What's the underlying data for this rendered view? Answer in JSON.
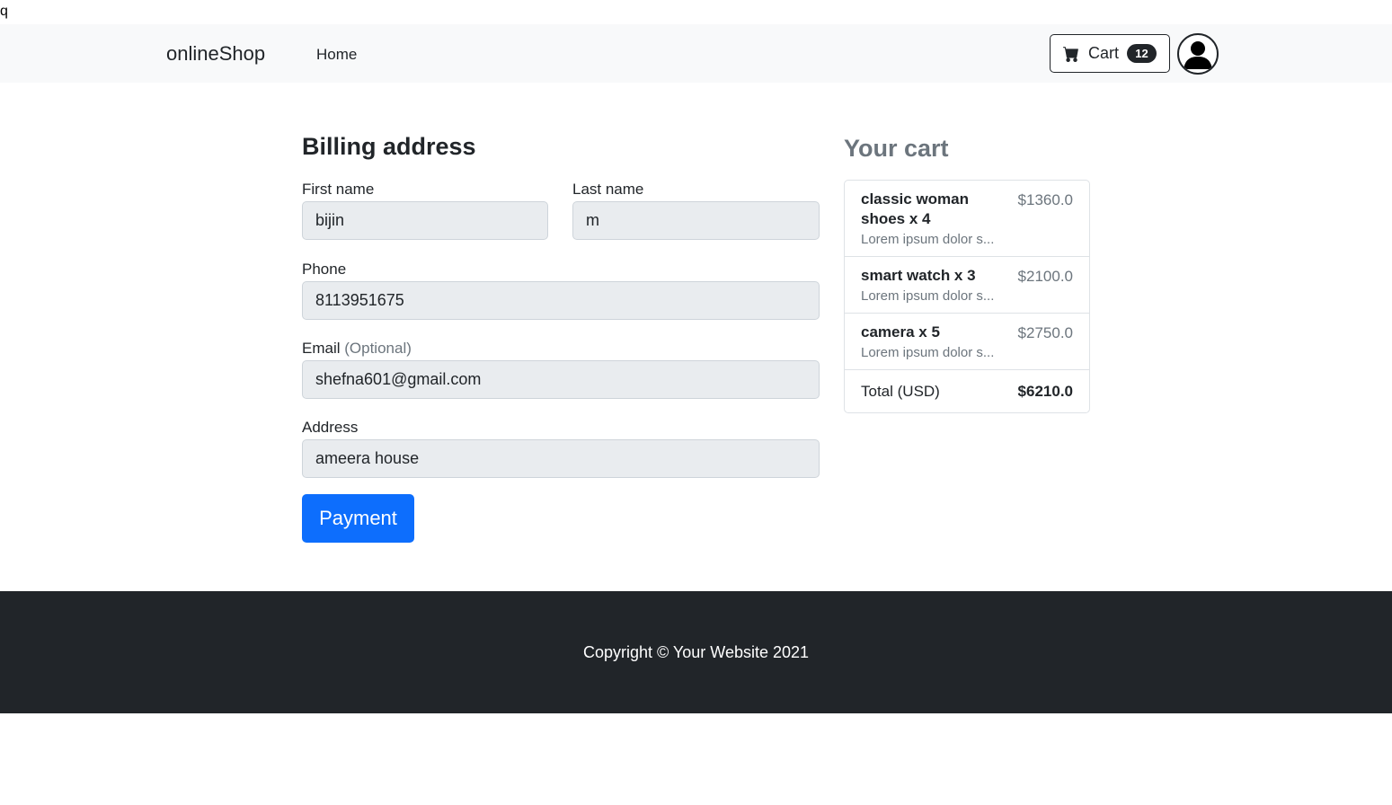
{
  "stray_text": "q",
  "navbar": {
    "brand": "onlineShop",
    "links": [
      {
        "label": "Home"
      }
    ],
    "cart": {
      "label": "Cart",
      "count": "12",
      "icon": "cart-icon"
    },
    "avatar_icon": "user-avatar-icon"
  },
  "billing": {
    "title": "Billing address",
    "first_name": {
      "label": "First name",
      "value": "bijin"
    },
    "last_name": {
      "label": "Last name",
      "value": "m"
    },
    "phone": {
      "label": "Phone",
      "value": "8113951675"
    },
    "email": {
      "label": "Email",
      "optional": "(Optional)",
      "value": "shefna601@gmail.com"
    },
    "address": {
      "label": "Address",
      "value": "ameera house"
    },
    "submit_label": "Payment"
  },
  "cart": {
    "title": "Your cart",
    "items": [
      {
        "name": "classic woman shoes x 4",
        "desc": "Lorem ipsum dolor s...",
        "price": "$1360.0"
      },
      {
        "name": "smart watch x 3",
        "desc": "Lorem ipsum dolor s...",
        "price": "$2100.0"
      },
      {
        "name": "camera x 5",
        "desc": "Lorem ipsum dolor s...",
        "price": "$2750.0"
      }
    ],
    "total_label": "Total (USD)",
    "total_value": "$6210.0"
  },
  "footer": {
    "copyright": "Copyright © Your Website 2021"
  },
  "colors": {
    "primary": "#0d6efd",
    "dark": "#212529",
    "navbar_bg": "#f8f9fa",
    "input_bg": "#e9ecef",
    "muted": "#6c757d"
  }
}
